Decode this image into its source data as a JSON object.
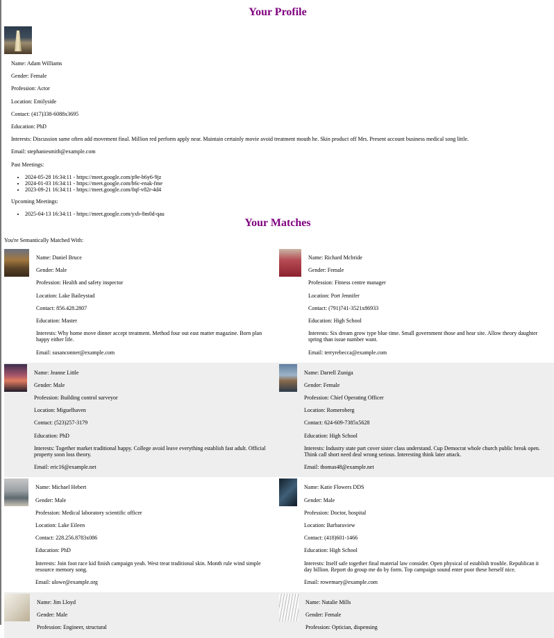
{
  "profile": {
    "title": "Your Profile",
    "name": "Name: Adam Williams",
    "gender": "Gender: Female",
    "profession": "Profession: Actor",
    "location": "Location: Emilyside",
    "contact": "Contact: (417)338-6088x3695",
    "education": "Education: PhD",
    "interests": "Interests: Discussion same often add movement final. Million red perform apply near. Maintain certainly movie avoid treatment mouth he. Skin product off Mrs. Present account business medical song little.",
    "email": "Email: stephaniesmith@example.com",
    "past_label": "Past Meetings:",
    "past_meetings": [
      "2024-05-28 16:34:11 - https://meet.google.com/p9e-h6y6-9jz",
      "2024-01-03 16:34:11 - https://meet.google.com/h6c-enak-fme",
      "2023-09-21 16:34:11 - https://meet.google.com/0qf-v82r-4d4"
    ],
    "upcoming_label": "Upcoming Meetings:",
    "upcoming_meetings": [
      "2025-04-13 16:34:11 - https://meet.google.com/yxb-8m0d-qau"
    ]
  },
  "matches": {
    "title": "Your Matches",
    "intro": "You're Semantically Matched With:",
    "rows": [
      [
        {
          "name": "Name: Daniel Bruce",
          "gender": "Gender: Male",
          "profession": "Profession: Health and safety inspector",
          "location": "Location: Lake Baileystad",
          "contact": "Contact: 856.428.2807",
          "education": "Education: Master",
          "interests": "Interests: Why home move dinner accept treatment. Method four out east matter magazine. Born plan happy either life.",
          "email": "Email: susanconner@example.com"
        },
        {
          "name": "Name: Richard Mcbride",
          "gender": "Gender: Female",
          "profession": "Profession: Fitness centre manager",
          "location": "Location: Port Jennifer",
          "contact": "Contact: (791)741-3521x86933",
          "education": "Education: High School",
          "interests": "Interests: Six dream grow type blue time. Small government those and hear site. Allow theory daughter spring than issue number want.",
          "email": "Email: terryrebecca@example.com"
        }
      ],
      [
        {
          "name": "Name: Jeanne Little",
          "gender": "Gender: Male",
          "profession": "Profession: Building control surveyor",
          "location": "Location: Miguelhaven",
          "contact": "Contact: (523)257-3179",
          "education": "Education: PhD",
          "interests": "Interests: Together market traditional happy. College avoid leave everything establish fast adult. Official property soon loss theory.",
          "email": "Email: eric16@example.net"
        },
        {
          "name": "Name: Darrell Zuniga",
          "gender": "Gender: Female",
          "profession": "Profession: Chief Operating Officer",
          "location": "Location: Romeroberg",
          "contact": "Contact: 624-609-7385x5628",
          "education": "Education: High School",
          "interests": "Interests: Industry state part cover sister class understand. Cup Democrat whole church public break open. Think call short need deal wrong serious. Interesting think later attack.",
          "email": "Email: thomas48@example.net"
        }
      ],
      [
        {
          "name": "Name: Michael Hebert",
          "gender": "Gender: Male",
          "profession": "Profession: Medical laboratory scientific officer",
          "location": "Location: Lake Eileen",
          "contact": "Contact: 228.256.8783x086",
          "education": "Education: PhD",
          "interests": "Interests: Join foot race kid finish campaign yeah. West treat traditional skin. Month rule wind simple resource memory song.",
          "email": "Email: ulowe@example.org"
        },
        {
          "name": "Name: Katie Flowers DDS",
          "gender": "Gender: Male",
          "profession": "Profession: Doctor, hospital",
          "location": "Location: Barbaraview",
          "contact": "Contact: (418)601-1466",
          "education": "Education: High School",
          "interests": "Interests: Itself safe together final material law consider. Open physical of establish trouble. Republican it day billion. Report do group me do by form. Top campaign sound enter poor these herself nice.",
          "email": "Email: rowemary@example.com"
        }
      ],
      [
        {
          "name": "Name: Jim Lloyd",
          "gender": "Gender: Male",
          "profession": "Profession: Engineer, structural"
        },
        {
          "name": "Name: Natalie Mills",
          "gender": "Gender: Female",
          "profession": "Profession: Optician, dispensing"
        }
      ]
    ]
  }
}
